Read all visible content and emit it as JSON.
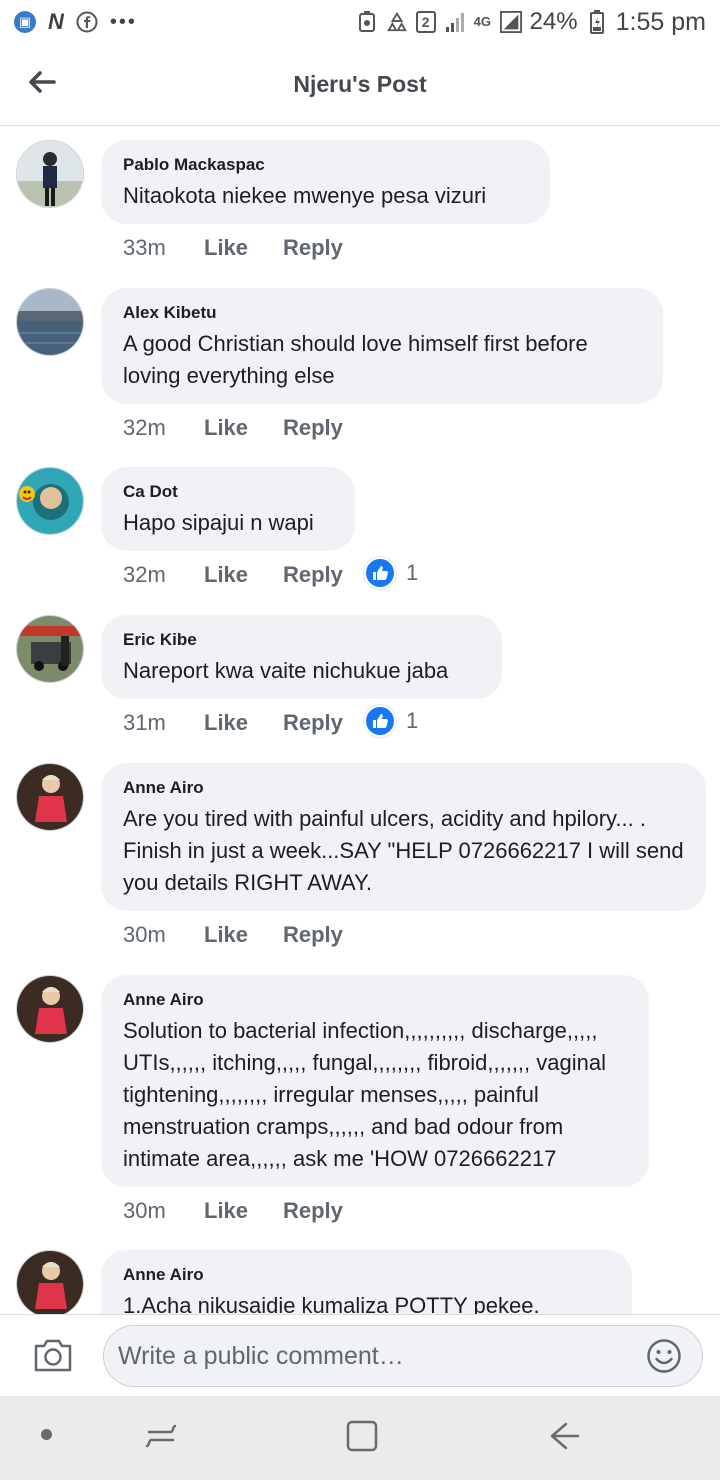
{
  "status_bar": {
    "network": "4G",
    "battery": "24%",
    "time": "1:55 pm",
    "sim": "2",
    "dots": "•••"
  },
  "header": {
    "title": "Njeru's Post"
  },
  "actions": {
    "like": "Like",
    "reply": "Reply"
  },
  "comments": [
    {
      "author": "Pablo Mackaspac",
      "text": "Nitaokota niekee mwenye pesa vizuri",
      "time": "33m"
    },
    {
      "author": "Alex Kibetu",
      "text": "A good Christian should love himself first before loving everything else",
      "time": "32m"
    },
    {
      "author": "Ca Dot",
      "text": "Hapo sipajui n wapi",
      "time": "32m",
      "likes": "1"
    },
    {
      "author": "Eric Kibe",
      "text": "Nareport kwa vaite nichukue jaba",
      "time": "31m",
      "likes": "1"
    },
    {
      "author": "Anne Airo",
      "text": "Are you tired with painful ulcers, acidity and hpilory... . Finish in just a week...SAY \"HELP 0726662217 I will send you details RIGHT AWAY.",
      "time": "30m"
    },
    {
      "author": "Anne Airo",
      "text": "Solution to bacterial infection,,,,,,,,,, discharge,,,,, UTIs,,,,,, itching,,,,, fungal,,,,,,,, fibroid,,,,,,, vaginal tightening,,,,,,,, irregular menses,,,,, painful menstruation cramps,,,,,, and bad odour from intimate area,,,,,, ask me 'HOW 0726662217",
      "time": "30m"
    },
    {
      "author": "Anne Airo",
      "text": "1.Acha  nikusaidie kumaliza POTTY pekee."
    }
  ],
  "composer": {
    "placeholder": "Write a public comment…"
  },
  "colors": {
    "bubble": "#f0f2f5",
    "like_blue": "#1877f2",
    "meta_gray": "#606770"
  }
}
